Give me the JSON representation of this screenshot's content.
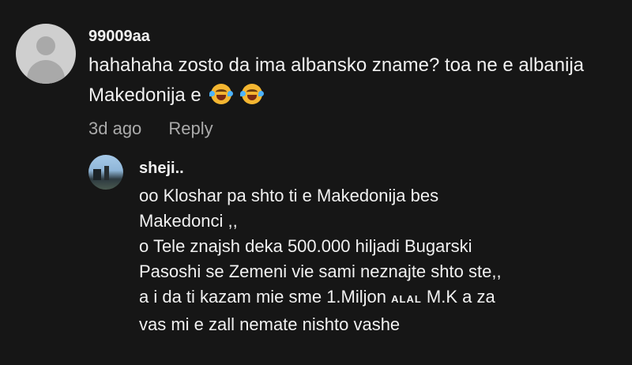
{
  "comment": {
    "author": "99009aa",
    "text": "hahahaha zosto da ima albansko zname? toa ne e albanija Makedonija e",
    "emojis": [
      "tears-of-joy-emoji",
      "tears-of-joy-emoji"
    ],
    "time": "3d ago",
    "reply_label": "Reply"
  },
  "reply": {
    "author": "sheji..",
    "lines": [
      "oo Kloshar pa shto ti e Makedonija bes",
      "Makedonci ,,",
      "o Tele znajsh deka 500.000 hiljadi Bugarski",
      "Pasoshi se Zemeni vie sami neznajte shto ste,,",
      "a i da ti kazam mie sme 1.Miljon",
      "ALAL",
      "M.K a za",
      "vas mi e zall nemate nishto vashe"
    ]
  }
}
